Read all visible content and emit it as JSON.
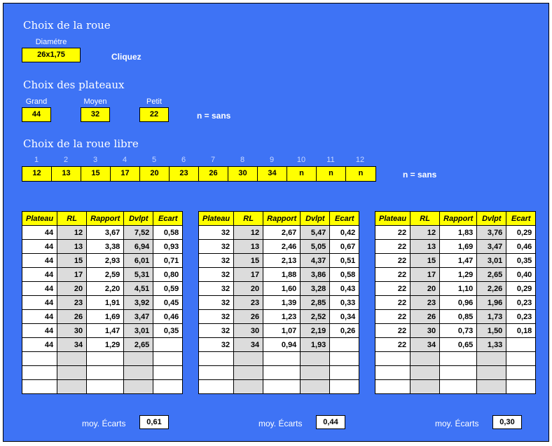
{
  "wheel": {
    "title": "Choix de la roue",
    "diameter_label": "Diamétre",
    "diameter_value": "26x1,75",
    "click_hint": "Cliquez"
  },
  "chainrings": {
    "title": "Choix des plateaux",
    "big_label": "Grand",
    "big_value": "44",
    "mid_label": "Moyen",
    "mid_value": "32",
    "small_label": "Petit",
    "small_value": "22",
    "note": "n = sans"
  },
  "freewheel": {
    "title": "Choix de la roue libre",
    "slots": [
      "1",
      "2",
      "3",
      "4",
      "5",
      "6",
      "7",
      "8",
      "9",
      "10",
      "11",
      "12"
    ],
    "values": [
      "12",
      "13",
      "15",
      "17",
      "20",
      "23",
      "26",
      "30",
      "34",
      "n",
      "n",
      "n"
    ],
    "note": "n = sans"
  },
  "headers": [
    "Plateau",
    "RL",
    "Rapport",
    "Dvlpt",
    "Ecart"
  ],
  "tables": [
    {
      "rows": [
        [
          "44",
          "12",
          "3,67",
          "7,52",
          "0,58"
        ],
        [
          "44",
          "13",
          "3,38",
          "6,94",
          "0,93"
        ],
        [
          "44",
          "15",
          "2,93",
          "6,01",
          "0,71"
        ],
        [
          "44",
          "17",
          "2,59",
          "5,31",
          "0,80"
        ],
        [
          "44",
          "20",
          "2,20",
          "4,51",
          "0,59"
        ],
        [
          "44",
          "23",
          "1,91",
          "3,92",
          "0,45"
        ],
        [
          "44",
          "26",
          "1,69",
          "3,47",
          "0,46"
        ],
        [
          "44",
          "30",
          "1,47",
          "3,01",
          "0,35"
        ],
        [
          "44",
          "34",
          "1,29",
          "2,65",
          ""
        ],
        [
          "",
          "",
          "",
          "",
          ""
        ],
        [
          "",
          "",
          "",
          "",
          ""
        ],
        [
          "",
          "",
          "",
          "",
          ""
        ]
      ],
      "avg_label": "moy. Écarts",
      "avg_value": "0,61"
    },
    {
      "rows": [
        [
          "32",
          "12",
          "2,67",
          "5,47",
          "0,42"
        ],
        [
          "32",
          "13",
          "2,46",
          "5,05",
          "0,67"
        ],
        [
          "32",
          "15",
          "2,13",
          "4,37",
          "0,51"
        ],
        [
          "32",
          "17",
          "1,88",
          "3,86",
          "0,58"
        ],
        [
          "32",
          "20",
          "1,60",
          "3,28",
          "0,43"
        ],
        [
          "32",
          "23",
          "1,39",
          "2,85",
          "0,33"
        ],
        [
          "32",
          "26",
          "1,23",
          "2,52",
          "0,34"
        ],
        [
          "32",
          "30",
          "1,07",
          "2,19",
          "0,26"
        ],
        [
          "32",
          "34",
          "0,94",
          "1,93",
          ""
        ],
        [
          "",
          "",
          "",
          "",
          ""
        ],
        [
          "",
          "",
          "",
          "",
          ""
        ],
        [
          "",
          "",
          "",
          "",
          ""
        ]
      ],
      "avg_label": "moy. Écarts",
      "avg_value": "0,44"
    },
    {
      "rows": [
        [
          "22",
          "12",
          "1,83",
          "3,76",
          "0,29"
        ],
        [
          "22",
          "13",
          "1,69",
          "3,47",
          "0,46"
        ],
        [
          "22",
          "15",
          "1,47",
          "3,01",
          "0,35"
        ],
        [
          "22",
          "17",
          "1,29",
          "2,65",
          "0,40"
        ],
        [
          "22",
          "20",
          "1,10",
          "2,26",
          "0,29"
        ],
        [
          "22",
          "23",
          "0,96",
          "1,96",
          "0,23"
        ],
        [
          "22",
          "26",
          "0,85",
          "1,73",
          "0,23"
        ],
        [
          "22",
          "30",
          "0,73",
          "1,50",
          "0,18"
        ],
        [
          "22",
          "34",
          "0,65",
          "1,33",
          ""
        ],
        [
          "",
          "",
          "",
          "",
          ""
        ],
        [
          "",
          "",
          "",
          "",
          ""
        ],
        [
          "",
          "",
          "",
          "",
          ""
        ]
      ],
      "avg_label": "moy. Écarts",
      "avg_value": "0,30"
    }
  ]
}
